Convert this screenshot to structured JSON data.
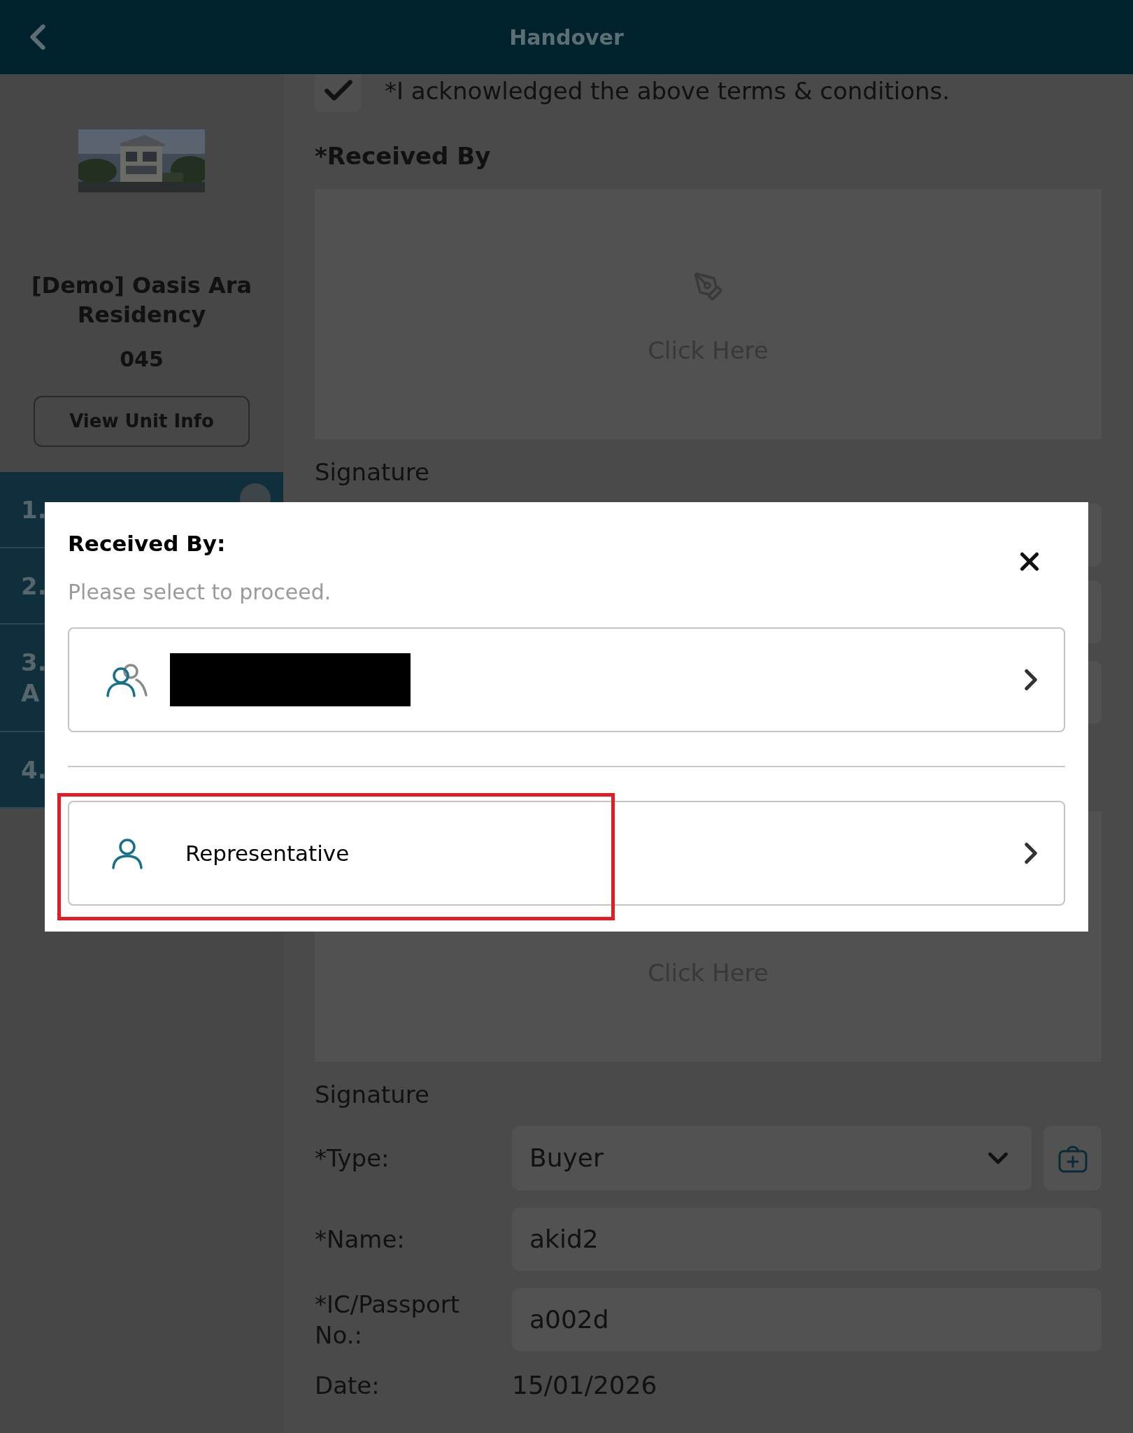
{
  "header": {
    "title": "Handover"
  },
  "sidebar": {
    "project": "[Demo] Oasis Ara Residency",
    "unit": "045",
    "button": "View Unit Info",
    "steps": [
      {
        "number": "1.",
        "completed": true
      },
      {
        "number": "2."
      },
      {
        "number": "3.",
        "label": "A"
      },
      {
        "number": "4."
      }
    ]
  },
  "acknowledgement": {
    "checked": true,
    "text": "*I acknowledged the above terms & conditions."
  },
  "received_by": {
    "heading": "*Received By",
    "pad_hint": "Click Here",
    "signature_label": "Signature"
  },
  "second_signature": {
    "pad_hint": "Click Here",
    "signature_label": "Signature",
    "fields": [
      {
        "kind": "select",
        "label": "*Type:",
        "value": "Buyer"
      },
      {
        "kind": "input",
        "label": "*Name:",
        "value": "akid2"
      },
      {
        "kind": "input",
        "label": "*IC/Passport No.:",
        "value": "a002d"
      },
      {
        "kind": "text",
        "label": "Date:",
        "value": "15/01/2026"
      }
    ]
  },
  "dialog": {
    "title": "Received By:",
    "subtitle": "Please select to proceed.",
    "options": [
      {
        "kind": "group",
        "redacted": true,
        "highlighted": false
      },
      {
        "kind": "person",
        "label": "Representative",
        "highlighted": true
      }
    ]
  }
}
